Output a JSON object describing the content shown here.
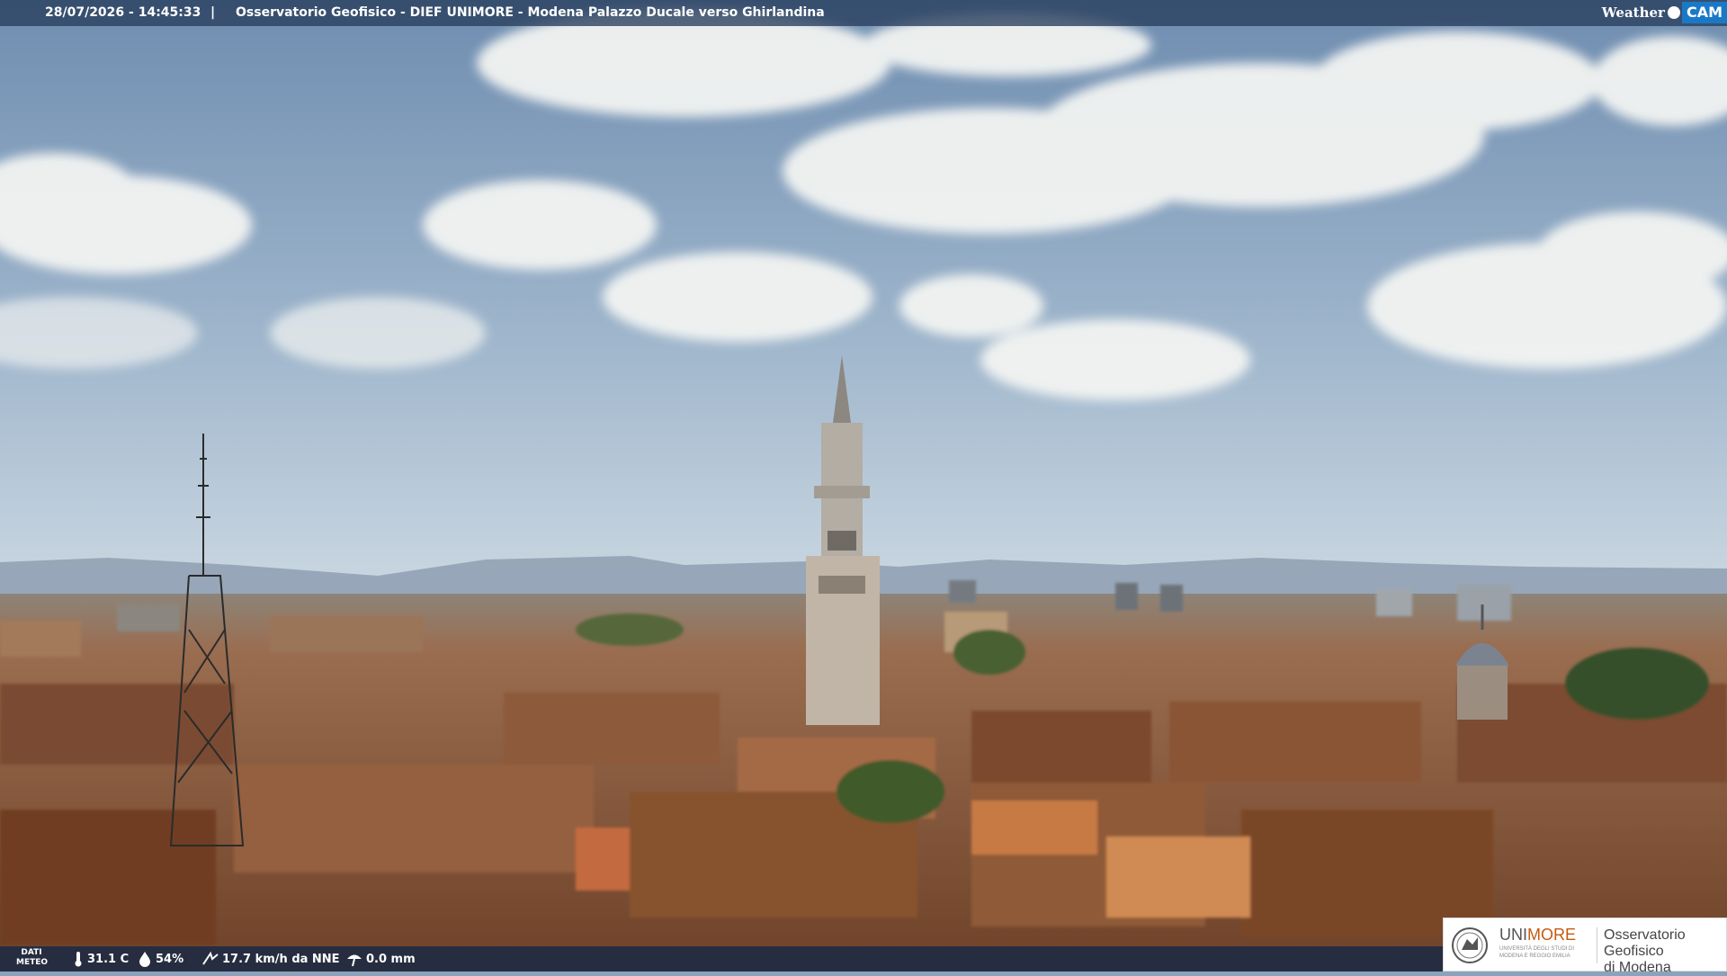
{
  "header": {
    "datetime": "28/07/2026 - 14:45:33",
    "separator": "|",
    "title": "Osservatorio Geofisico - DIEF UNIMORE - Modena Palazzo Ducale verso Ghirlandina"
  },
  "brand": {
    "weather": "Weather",
    "cam": "CAM",
    "accent": "#1a79c7"
  },
  "weather": {
    "label": "DATI METEO",
    "temperature": "31.1 C",
    "humidity": "54%",
    "wind": "17.7 km/h da NNE",
    "rain": "0.0 mm",
    "icons": [
      "thermometer-icon",
      "humidity-icon",
      "wind-icon",
      "rain-gauge-icon"
    ]
  },
  "logo": {
    "uni_a": "UNI",
    "uni_b": "MORE",
    "uni_sub_1": "UNIVERSITÀ DEGLI STUDI DI",
    "uni_sub_2": "MODENA E REGGIO EMILIA",
    "obs_line1": "Osservatorio Geofisico",
    "obs_line2": "di Modena",
    "accent": "#c55a11"
  },
  "scene": {
    "description_colors": {
      "sky_top": "#6f8db0",
      "sky_mid": "#b8cbdb",
      "haze": "#d8dfe6",
      "roofs": "#9a6443"
    }
  }
}
